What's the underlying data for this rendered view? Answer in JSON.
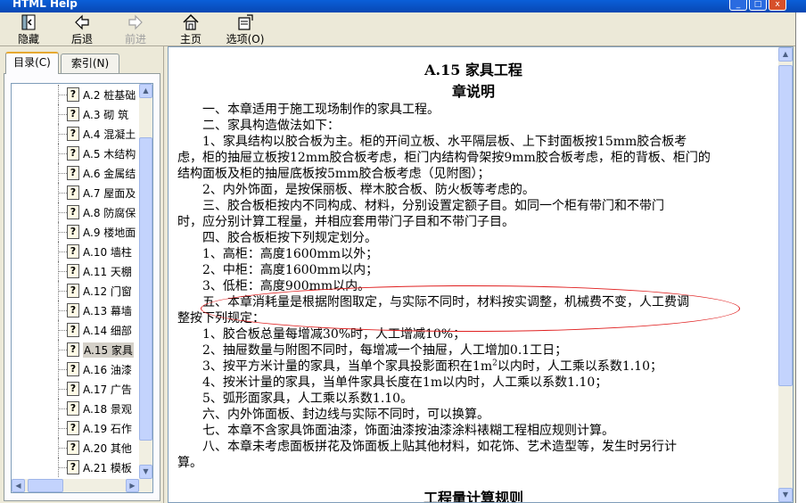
{
  "window": {
    "title": "HTML Help",
    "buttons": {
      "minimize": "_",
      "maximize": "□",
      "close": "x"
    }
  },
  "toolbar": {
    "hide": "隐藏",
    "back": "后退",
    "forward": "前进",
    "home": "主页",
    "options": "选项(O)"
  },
  "tabs": {
    "contents": "目录(C)",
    "index": "索引(N)"
  },
  "tree": {
    "items": [
      "A.2  桩基础",
      "A.3  砌 筑",
      "A.4  混凝土",
      "A.5  木结构",
      "A.6  金属结",
      "A.7  屋面及",
      "A.8  防腐保",
      "A.9  楼地面",
      "A.10  墙柱",
      "A.11  天棚",
      "A.12  门窗",
      "A.13  幕墙",
      "A.14  细部",
      "A.15  家具",
      "A.16  油漆",
      "A.17  广告",
      "A.18 景观",
      "A.19 石作",
      "A.20  其他",
      "A.21  模板"
    ],
    "selected_index": 13,
    "node_icon": "help-page-icon",
    "node_icon_glyph": "?"
  },
  "doc": {
    "title": "A.15   家具工程",
    "subtitle": "章说明",
    "lines": [
      "一、本章适用于施工现场制作的家具工程。",
      "二、家具构造做法如下：",
      "1、家具结构以胶合板为主。柜的开间立板、水平隔层板、上下封面板按15mm胶合板考",
      "虑，柜的抽屉立板按12mm胶合板考虑，柜门内结构骨架按9mm胶合板考虑，柜的背板、柜门的",
      "结构面板及柜的抽屉底板按5mm胶合板考虑（见附图）；",
      "2、内外饰面，是按保丽板、榉木胶合板、防火板等考虑的。",
      "三、胶合板柜按内不同构成、材料，分别设置定额子目。如同一个柜有带门和不带门",
      "时，应分别计算工程量，并相应套用带门子目和不带门子目。",
      "四、胶合板柜按下列规定划分。",
      "1、高柜：高度1600mm以外；",
      "2、中柜：高度1600mm以内；",
      "3、低柜：高度900mm以内。",
      "五、本章消耗量是根据附图取定，与实际不同时，材料按实调整，机械费不变，人工费调",
      "整按下列规定：",
      "1、胶合板总量每增减30%时，人工增减10%；",
      "2、抽屉数量与附图不同时，每增减一个抽屉，人工增加0.1工日；",
      "以内时，人工乘以系数1.10；",
      "4、按米计量的家具，当单件家具长度在1m以内时，人工乘以系数1.10；",
      "5、弧形面家具，人工乘以系数1.10。",
      "六、内外饰面板、封边线与实际不同时，可以换算。",
      "七、本章不含家具饰面油漆，饰面油漆按油漆涂料裱糊工程相应规则计算。",
      "八、本章未考虑面板拼花及饰面板上贴其他材料，如花饰、艺术造型等，发生时另行计",
      "算。"
    ],
    "line3_prefix": "3、按平方米计量的家具，当单个家具投影面积在1m",
    "line3_sup": "2",
    "next_heading": "工程量计算规则"
  },
  "colors": {
    "highlight_ellipse": "#e02020",
    "title_bar": "#0a5fd8"
  }
}
